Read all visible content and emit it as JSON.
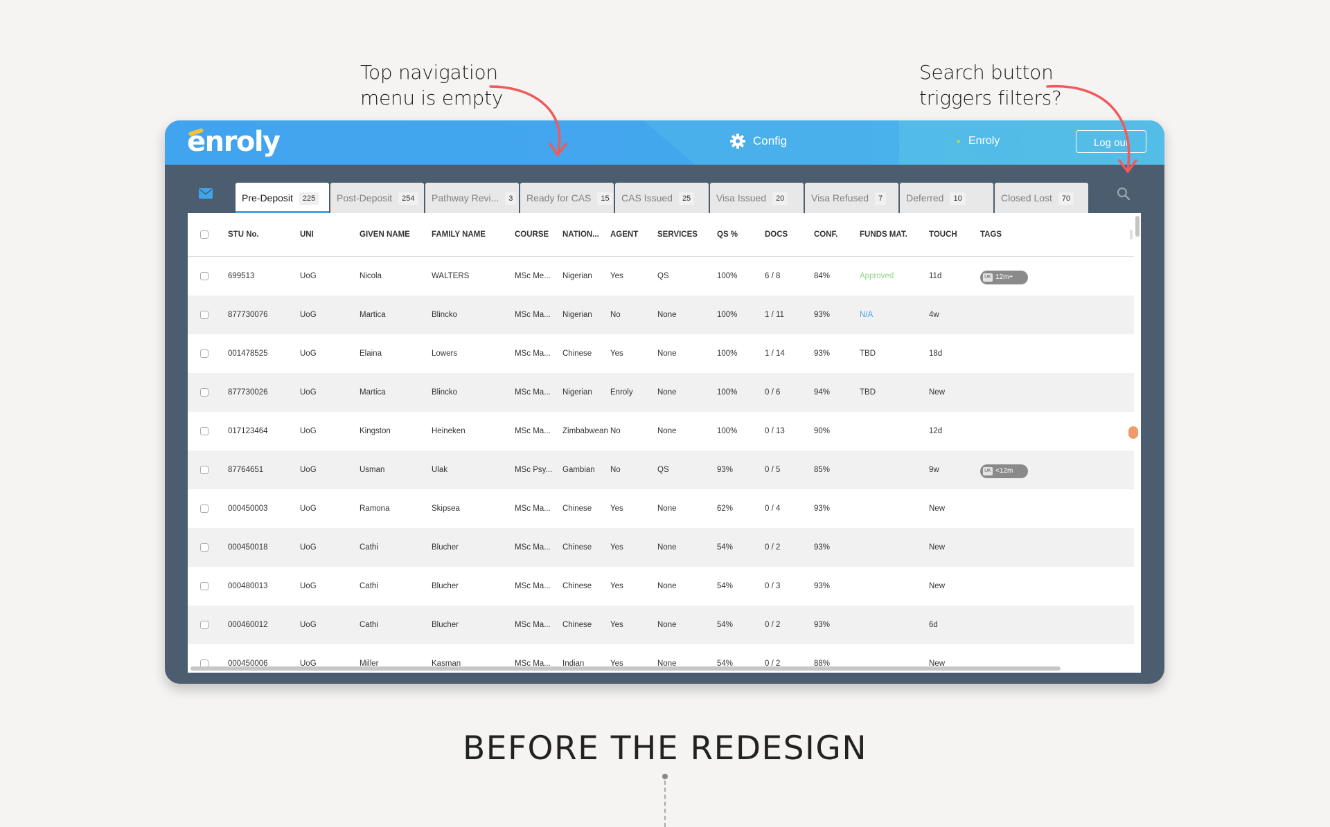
{
  "annotations": {
    "left_line1": "Top navigation",
    "left_line2": "menu is empty",
    "right_line1": "Search button",
    "right_line2": "triggers filters?",
    "arrow_color": "#ef5a5a"
  },
  "header": {
    "logo": "enroly",
    "config_label": "Config",
    "user_label": "Enroly",
    "logout_label": "Log out",
    "gradient_colors": [
      "#41a4ee",
      "#52b9e6"
    ]
  },
  "tabs": [
    {
      "label": "Pre-Deposit",
      "count": "225",
      "active": true
    },
    {
      "label": "Post-Deposit",
      "count": "254",
      "active": false
    },
    {
      "label": "Pathway Revi...",
      "count": "3",
      "active": false
    },
    {
      "label": "Ready for CAS",
      "count": "15",
      "active": false
    },
    {
      "label": "CAS Issued",
      "count": "25",
      "active": false
    },
    {
      "label": "Visa Issued",
      "count": "20",
      "active": false
    },
    {
      "label": "Visa Refused",
      "count": "7",
      "active": false
    },
    {
      "label": "Deferred",
      "count": "10",
      "active": false
    },
    {
      "label": "Closed Lost",
      "count": "70",
      "active": false
    }
  ],
  "icons": {
    "mail": "mail-icon",
    "search": "search-icon",
    "config": "gear-icon",
    "tag_flag": "uk-flag-icon"
  },
  "table": {
    "columns": [
      "STU No.",
      "UNI",
      "GIVEN NAME",
      "FAMILY NAME",
      "COURSE",
      "NATION...",
      "AGENT",
      "SERVICES",
      "QS %",
      "DOCS",
      "CONF.",
      "FUNDS MAT.",
      "TOUCH",
      "TAGS"
    ],
    "rows": [
      {
        "stu": "699513",
        "uni": "UoG",
        "given": "Nicola",
        "family": "WALTERS",
        "course": "MSc Me...",
        "nation": "Nigerian",
        "agent": "Yes",
        "services": "QS",
        "qs": "100%",
        "docs": "6 / 8",
        "conf": "84%",
        "funds": "Approved",
        "touch": "11d",
        "tag": "12m+"
      },
      {
        "stu": "877730076",
        "uni": "UoG",
        "given": "Martica",
        "family": "Blincko",
        "course": "MSc Ma...",
        "nation": "Nigerian",
        "agent": "No",
        "services": "None",
        "qs": "100%",
        "docs": "1 / 11",
        "conf": "93%",
        "funds": "N/A",
        "touch": "4w",
        "tag": ""
      },
      {
        "stu": "001478525",
        "uni": "UoG",
        "given": "Elaina",
        "family": "Lowers",
        "course": "MSc Ma...",
        "nation": "Chinese",
        "agent": "Yes",
        "services": "None",
        "qs": "100%",
        "docs": "1 / 14",
        "conf": "93%",
        "funds": "TBD",
        "touch": "18d",
        "tag": ""
      },
      {
        "stu": "877730026",
        "uni": "UoG",
        "given": "Martica",
        "family": "Blincko",
        "course": "MSc Ma...",
        "nation": "Nigerian",
        "agent": "Enroly",
        "services": "None",
        "qs": "100%",
        "docs": "0 / 6",
        "conf": "94%",
        "funds": "TBD",
        "touch": "New",
        "tag": ""
      },
      {
        "stu": "017123464",
        "uni": "UoG",
        "given": "Kingston",
        "family": "Heineken",
        "course": "MSc Ma...",
        "nation": "Zimbabwean",
        "agent": "No",
        "services": "None",
        "qs": "100%",
        "docs": "0 / 13",
        "conf": "90%",
        "funds": "",
        "touch": "12d",
        "tag": ""
      },
      {
        "stu": "87764651",
        "uni": "UoG",
        "given": "Usman",
        "family": "Ulak",
        "course": "MSc Psy...",
        "nation": "Gambian",
        "agent": "No",
        "services": "QS",
        "qs": "93%",
        "docs": "0 / 5",
        "conf": "85%",
        "funds": "",
        "touch": "9w",
        "tag": "<12m"
      },
      {
        "stu": "000450003",
        "uni": "UoG",
        "given": "Ramona",
        "family": "Skipsea",
        "course": "MSc Ma...",
        "nation": "Chinese",
        "agent": "Yes",
        "services": "None",
        "qs": "62%",
        "docs": "0 / 4",
        "conf": "93%",
        "funds": "",
        "touch": "New",
        "tag": ""
      },
      {
        "stu": "000450018",
        "uni": "UoG",
        "given": "Cathi",
        "family": "Blucher",
        "course": "MSc Ma...",
        "nation": "Chinese",
        "agent": "Yes",
        "services": "None",
        "qs": "54%",
        "docs": "0 / 2",
        "conf": "93%",
        "funds": "",
        "touch": "New",
        "tag": ""
      },
      {
        "stu": "000480013",
        "uni": "UoG",
        "given": "Cathi",
        "family": "Blucher",
        "course": "MSc Ma...",
        "nation": "Chinese",
        "agent": "Yes",
        "services": "None",
        "qs": "54%",
        "docs": "0 / 3",
        "conf": "93%",
        "funds": "",
        "touch": "New",
        "tag": ""
      },
      {
        "stu": "000460012",
        "uni": "UoG",
        "given": "Cathi",
        "family": "Blucher",
        "course": "MSc Ma...",
        "nation": "Chinese",
        "agent": "Yes",
        "services": "None",
        "qs": "54%",
        "docs": "0 / 2",
        "conf": "93%",
        "funds": "",
        "touch": "6d",
        "tag": ""
      },
      {
        "stu": "000450006",
        "uni": "UoG",
        "given": "Miller",
        "family": "Kasman",
        "course": "MSc Ma...",
        "nation": "Indian",
        "agent": "Yes",
        "services": "None",
        "qs": "54%",
        "docs": "0 / 2",
        "conf": "88%",
        "funds": "",
        "touch": "New",
        "tag": ""
      }
    ],
    "colors": {
      "approved": "#8fd48a",
      "na": "#4aa3df",
      "tab_underline": "#4aa3df"
    }
  },
  "caption": "BEFORE THE REDESIGN"
}
